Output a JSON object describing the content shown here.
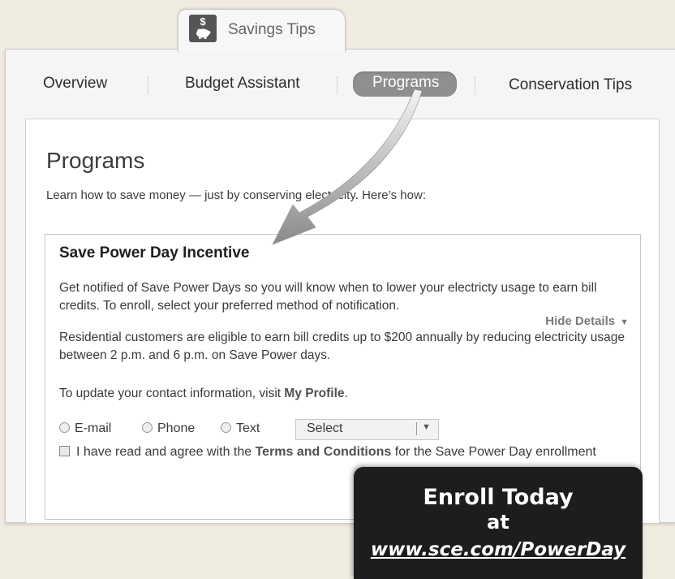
{
  "top_tab": {
    "icon": "piggy-bank-icon",
    "icon_symbol": "$",
    "label": "Savings Tips"
  },
  "nav": {
    "items": [
      {
        "label": "Overview",
        "active": false
      },
      {
        "label": "Budget Assistant",
        "active": false
      },
      {
        "label": "Programs",
        "active": true
      },
      {
        "label": "Conservation Tips",
        "active": false
      }
    ]
  },
  "page": {
    "title": "Programs",
    "intro": "Learn how to save money — just by conserving electricity. Here’s how:"
  },
  "card": {
    "title": "Save Power Day Incentive",
    "paragraph1": "Get notified of Save Power Days so you will know when to lower your electricty usage to earn bill credits. To enroll, select your preferred method of notification.",
    "hide_details": "Hide Details",
    "paragraph2": "Residential customers are eligible to earn bill credits up to $200 annually by reducing electricity usage between 2 p.m. and 6 p.m. on Save Power days.",
    "contact_prefix": "To update your contact information, visit ",
    "contact_link": "My Profile",
    "contact_suffix": ".",
    "options": [
      "E-mail",
      "Phone",
      "Text"
    ],
    "select_value": "Select",
    "agree_prefix": "I have read and agree with the ",
    "agree_link": "Terms and Conditions",
    "agree_suffix": " for the Save Power Day enrollment"
  },
  "promo": {
    "line1": "Enroll Today",
    "line2": "at",
    "line3": "www.sce.com/PowerDay"
  },
  "colors": {
    "background": "#f1ece0",
    "active_tab": "#8f8f8f",
    "promo_box": "#1d1d1d"
  }
}
